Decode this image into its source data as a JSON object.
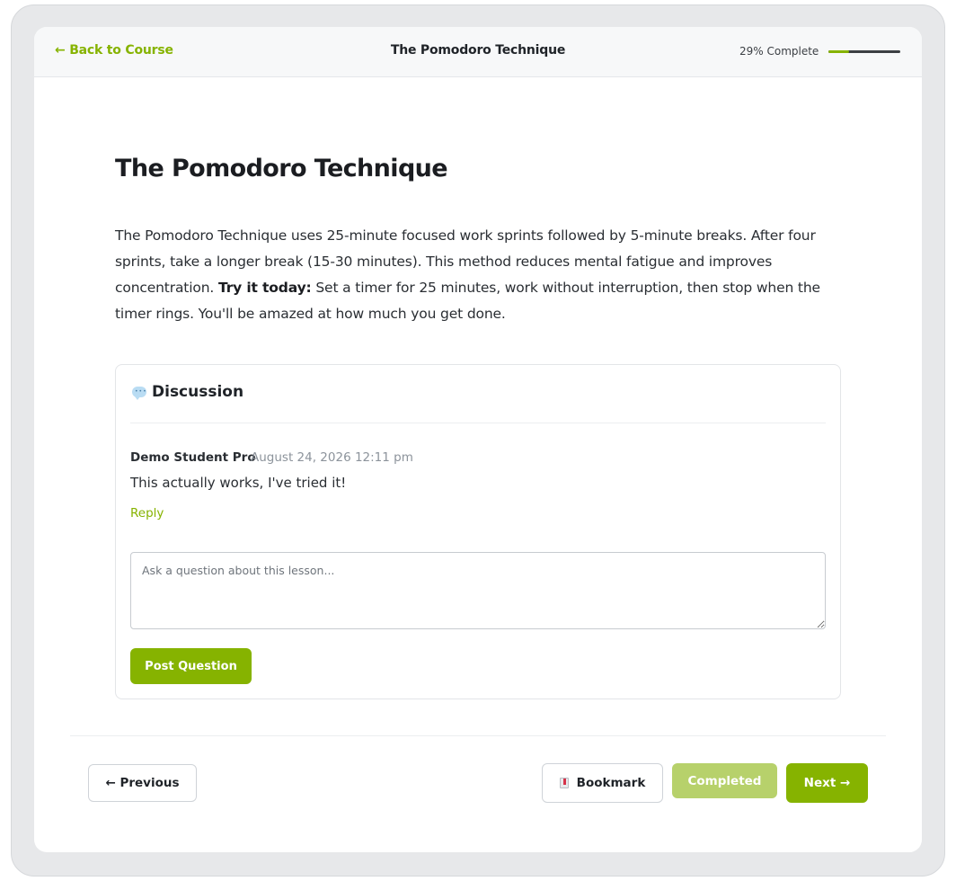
{
  "header": {
    "back_label": "← Back to Course",
    "title": "The Pomodoro Technique",
    "progress_label": "29% Complete",
    "progress_value": 0.29
  },
  "lesson": {
    "title": "The Pomodoro Technique",
    "body_intro": "The Pomodoro Technique uses 25-minute focused work sprints followed by 5-minute breaks. After four sprints, take a longer break (15-30 minutes). This method reduces mental fatigue and improves concentration. ",
    "body_emphasis": "Try it today:",
    "body_outro": " Set a timer for 25 minutes, work without interruption, then stop when the timer rings. You'll be amazed at how much you get done."
  },
  "discussion": {
    "icon": "speech-bubble-icon",
    "title": "Discussion",
    "comments": [
      {
        "author": "Demo Student Pro",
        "date": "August 24, 2026 12:11 pm",
        "text": "This actually works, I've tried it!",
        "reply_label": "Reply"
      }
    ],
    "input_placeholder": "Ask a question about this lesson...",
    "post_label": "Post Question"
  },
  "navigation": {
    "previous_label": "← Previous",
    "bookmark_label": "Bookmark",
    "completed_label": "Completed",
    "next_label": "Next →"
  },
  "colors": {
    "accent": "#86b300",
    "accent_light": "#b7d16b",
    "frame_bg": "#e7e8ea"
  }
}
